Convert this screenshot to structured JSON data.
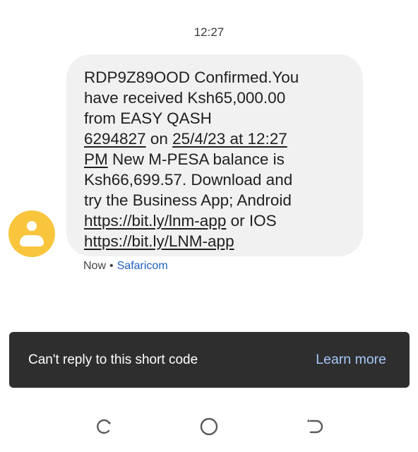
{
  "status": {
    "time": "12:27"
  },
  "message": {
    "lines": [
      "RDP9Z89OOD Confirmed.You",
      "have received Ksh65,000.00",
      "from EASY QASH",
      "6294827",
      " on ",
      "25/4/23 at 12:27",
      "PM",
      " New M-PESA balance is",
      "Ksh66,699.57. Download and",
      "try the Business App; Android",
      "https://bit.ly/lnm-app",
      " or IOS",
      "https://bit.ly/LNM-app"
    ],
    "time_label": "Now",
    "separator": "•",
    "sender": "Safaricom"
  },
  "snackbar": {
    "text": "Can't reply to this short code",
    "action": "Learn more"
  },
  "colors": {
    "avatar": "#f8c53c",
    "bubble": "#f1f1f1",
    "snackbar_bg": "#2e2e2e",
    "snackbar_action": "#a8c7fa",
    "sender_link": "#1f5fbf"
  },
  "navbar": {
    "icons": [
      "recent-apps-icon",
      "home-icon",
      "back-icon"
    ]
  }
}
